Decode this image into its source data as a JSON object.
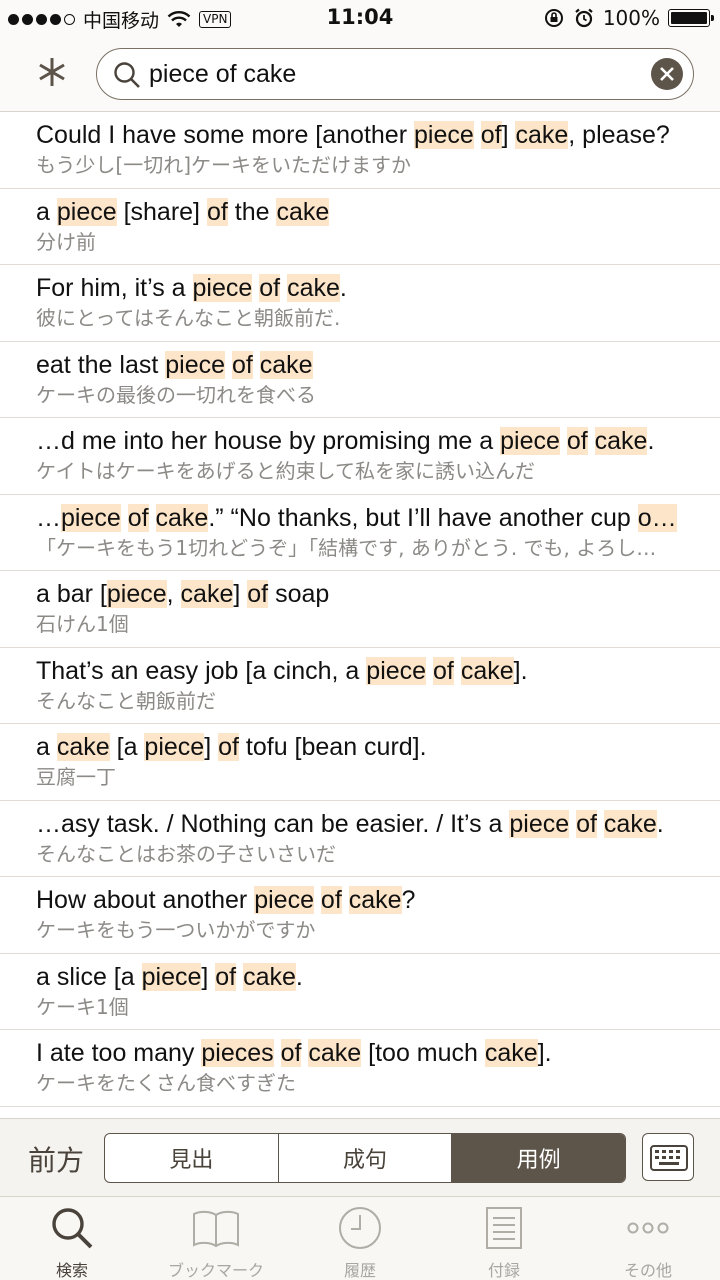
{
  "status_bar": {
    "carrier": "中国移动",
    "vpn": "VPN",
    "time": "11:04",
    "battery": "100%"
  },
  "search": {
    "query": "piece of cake"
  },
  "results": [
    {
      "en": [
        [
          "Could I have some more [another ",
          false
        ],
        [
          "piece",
          true
        ],
        [
          " ",
          false
        ],
        [
          "of",
          true
        ],
        [
          "] ",
          false
        ],
        [
          "cake",
          true
        ],
        [
          ", please?",
          false
        ]
      ],
      "ja": "もう少し[一切れ]ケーキをいただけますか"
    },
    {
      "en": [
        [
          "a ",
          false
        ],
        [
          "piece",
          true
        ],
        [
          " [share] ",
          false
        ],
        [
          "of",
          true
        ],
        [
          " the ",
          false
        ],
        [
          "cake",
          true
        ]
      ],
      "ja": "分け前"
    },
    {
      "en": [
        [
          "For him, it’s a ",
          false
        ],
        [
          "piece",
          true
        ],
        [
          " ",
          false
        ],
        [
          "of",
          true
        ],
        [
          " ",
          false
        ],
        [
          "cake",
          true
        ],
        [
          ".",
          false
        ]
      ],
      "ja": "彼にとってはそんなこと朝飯前だ."
    },
    {
      "en": [
        [
          "eat the last ",
          false
        ],
        [
          "piece",
          true
        ],
        [
          " ",
          false
        ],
        [
          "of",
          true
        ],
        [
          " ",
          false
        ],
        [
          "cake",
          true
        ]
      ],
      "ja": "ケーキの最後の一切れを食べる"
    },
    {
      "en": [
        [
          "…d me into her house by promising me a ",
          false
        ],
        [
          "piece",
          true
        ],
        [
          " ",
          false
        ],
        [
          "of",
          true
        ],
        [
          " ",
          false
        ],
        [
          "cake",
          true
        ],
        [
          ".",
          false
        ]
      ],
      "ja": "ケイトはケーキをあげると約束して私を家に誘い込んだ"
    },
    {
      "en": [
        [
          "…",
          false
        ],
        [
          "piece",
          true
        ],
        [
          " ",
          false
        ],
        [
          "of",
          true
        ],
        [
          " ",
          false
        ],
        [
          "cake",
          true
        ],
        [
          ".” “No thanks, but I’ll have another cup ",
          false
        ],
        [
          "o…",
          true
        ]
      ],
      "ja": "「ケーキをもう1切れどうぞ」「結構です, ありがとう. でも, よろし…"
    },
    {
      "en": [
        [
          "a bar [",
          false
        ],
        [
          "piece",
          true
        ],
        [
          ", ",
          false
        ],
        [
          "cake",
          true
        ],
        [
          "] ",
          false
        ],
        [
          "of",
          true
        ],
        [
          " soap",
          false
        ]
      ],
      "ja": "石けん1個"
    },
    {
      "en": [
        [
          "That’s an easy job [a cinch, a ",
          false
        ],
        [
          "piece",
          true
        ],
        [
          " ",
          false
        ],
        [
          "of",
          true
        ],
        [
          " ",
          false
        ],
        [
          "cake",
          true
        ],
        [
          "].",
          false
        ]
      ],
      "ja": "そんなこと朝飯前だ"
    },
    {
      "en": [
        [
          "a ",
          false
        ],
        [
          "cake",
          true
        ],
        [
          " [a ",
          false
        ],
        [
          "piece",
          true
        ],
        [
          "] ",
          false
        ],
        [
          "of",
          true
        ],
        [
          " tofu [bean curd].",
          false
        ]
      ],
      "ja": "豆腐一丁"
    },
    {
      "en": [
        [
          "…asy task. / Nothing can be easier. / It’s a ",
          false
        ],
        [
          "piece",
          true
        ],
        [
          " ",
          false
        ],
        [
          "of",
          true
        ],
        [
          " ",
          false
        ],
        [
          "cake",
          true
        ],
        [
          ".",
          false
        ]
      ],
      "ja": "そんなことはお茶の子さいさいだ"
    },
    {
      "en": [
        [
          "How about another ",
          false
        ],
        [
          "piece",
          true
        ],
        [
          " ",
          false
        ],
        [
          "of",
          true
        ],
        [
          " ",
          false
        ],
        [
          "cake",
          true
        ],
        [
          "?",
          false
        ]
      ],
      "ja": "ケーキをもう一ついかがですか"
    },
    {
      "en": [
        [
          "a slice [a ",
          false
        ],
        [
          "piece",
          true
        ],
        [
          "] ",
          false
        ],
        [
          "of",
          true
        ],
        [
          " ",
          false
        ],
        [
          "cake",
          true
        ],
        [
          ".",
          false
        ]
      ],
      "ja": "ケーキ1個"
    },
    {
      "en": [
        [
          "I ate too many ",
          false
        ],
        [
          "pieces",
          true
        ],
        [
          " ",
          false
        ],
        [
          "of",
          true
        ],
        [
          " ",
          false
        ],
        [
          "cake",
          true
        ],
        [
          " [too much ",
          false
        ],
        [
          "cake",
          true
        ],
        [
          "].",
          false
        ]
      ],
      "ja": "ケーキをたくさん食べすぎた"
    }
  ],
  "segment_bar": {
    "mode_label": "前方",
    "segments": [
      "見出",
      "成句",
      "用例"
    ],
    "active_segment": 2
  },
  "tab_bar": {
    "tabs": [
      {
        "label": "検索",
        "icon": "search-icon"
      },
      {
        "label": "ブックマーク",
        "icon": "book-icon"
      },
      {
        "label": "履歴",
        "icon": "clock-icon"
      },
      {
        "label": "付録",
        "icon": "document-icon"
      },
      {
        "label": "その他",
        "icon": "more-icon"
      }
    ],
    "active_tab": 0
  },
  "colors": {
    "accent": "#5e554a",
    "highlight": "#fde5c9",
    "secondary_text": "#8c8a86"
  }
}
